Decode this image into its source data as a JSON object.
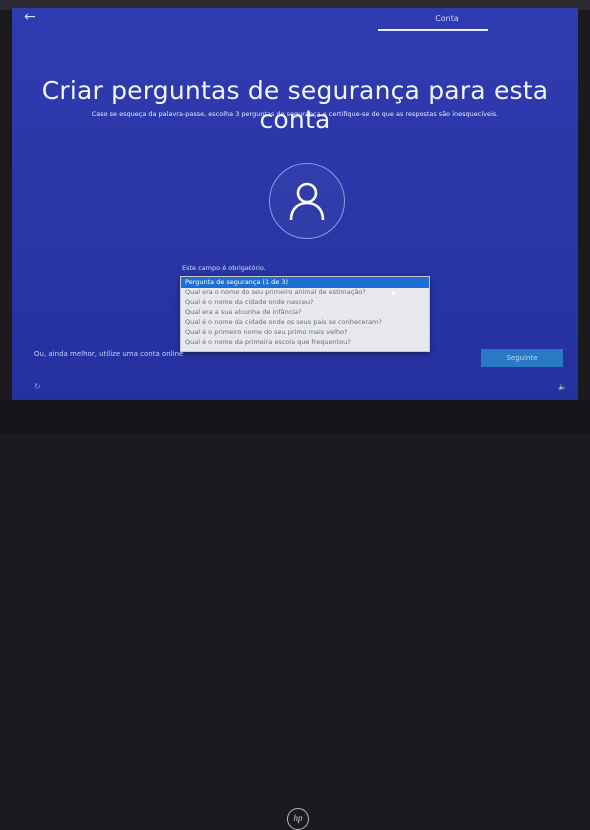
{
  "topbar": {
    "back_icon": "←",
    "tab_label": "Conta"
  },
  "header": {
    "title": "Criar perguntas de segurança para esta conta",
    "subtitle": "Caso se esqueça da palavra-passe, escolha 3 perguntas de segurança e certifique-se de que as respostas são inesquecíveis."
  },
  "form": {
    "required_label": "Este campo é obrigatório.",
    "dropdown": {
      "selected": "Pergunta de segurança (1 de 3)",
      "options": [
        "Qual era o nome do seu primeiro animal de estimação?",
        "Qual é o nome da cidade onde nasceu?",
        "Qual era a sua alcunha de infância?",
        "Qual é o nome da cidade onde os seus pais se conheceram?",
        "Qual é o primeiro nome do seu primo mais velho?",
        "Qual é o nome da primeira escola que frequentou?"
      ]
    }
  },
  "footer": {
    "offline_link": "Ou, ainda melhor, utilize uma conta online",
    "next_button": "Seguinte",
    "left_icon": "↻",
    "right_icon": "🔈"
  },
  "device": {
    "logo": "hp"
  }
}
